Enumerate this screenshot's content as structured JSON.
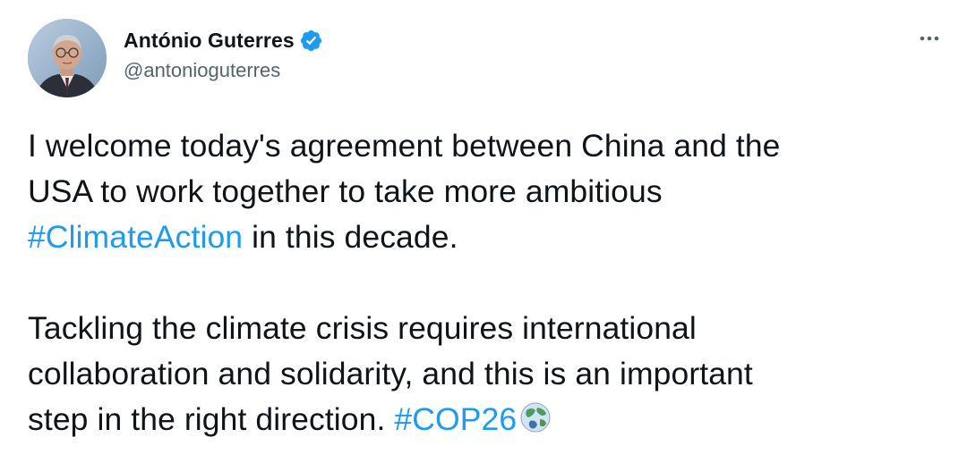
{
  "author": {
    "display_name": "António Guterres",
    "handle": "@antonioguterres",
    "verified": true,
    "verified_color": "#1d9bf0"
  },
  "tweet": {
    "para1": {
      "line1": "I welcome today's agreement between China and the",
      "line2": "USA to work together to take more ambitious",
      "hashtag": "#ClimateAction",
      "line3_rest": " in this decade."
    },
    "para2": {
      "line1": "Tackling the climate crisis requires international",
      "line2": "collaboration and solidarity, and this is an important",
      "line3": "step in the right direction. ",
      "hashtag": "#COP26",
      "emoji": "globe-emoji"
    }
  },
  "colors": {
    "text": "#0f1419",
    "secondary": "#536471",
    "link": "#1d9bf0"
  },
  "icons": {
    "more": "more-options-icon",
    "verified": "verified-badge-icon"
  }
}
